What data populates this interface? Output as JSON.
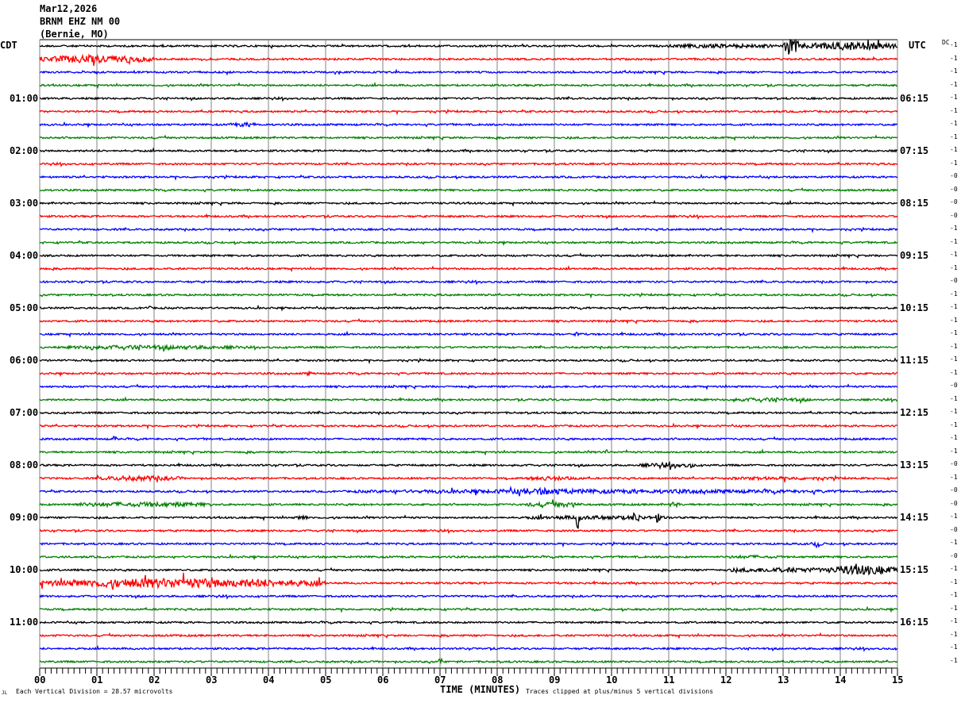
{
  "header": {
    "date": "Mar12,2026",
    "station": "BRNM EHZ NM 00",
    "location": "(Bernie, MO)"
  },
  "left_timezone": "CDT",
  "right_timezone": "UTC",
  "dc_label": "DC",
  "footer": {
    "mark": "JL",
    "scale": "Each Vertical Division =   28.57 microvolts",
    "clip_note": "Traces clipped at plus/minus 5 vertical divisions"
  },
  "chart_data": {
    "type": "line",
    "title": "",
    "xlabel": "TIME (MINUTES)",
    "xlim": [
      0,
      15
    ],
    "x_tick_labels": [
      "00",
      "01",
      "02",
      "03",
      "04",
      "05",
      "06",
      "07",
      "08",
      "09",
      "10",
      "11",
      "12",
      "13",
      "14",
      "15"
    ],
    "grid": "vertical lines every minute",
    "trace_colors": [
      "#000000",
      "#ff0000",
      "#0000ff",
      "#008000"
    ],
    "row_count": 48,
    "left_hour_labels": [
      {
        "row": 4,
        "label": "01:00"
      },
      {
        "row": 8,
        "label": "02:00"
      },
      {
        "row": 12,
        "label": "03:00"
      },
      {
        "row": 16,
        "label": "04:00"
      },
      {
        "row": 20,
        "label": "05:00"
      },
      {
        "row": 24,
        "label": "06:00"
      },
      {
        "row": 28,
        "label": "07:00"
      },
      {
        "row": 32,
        "label": "08:00"
      },
      {
        "row": 36,
        "label": "09:00"
      },
      {
        "row": 40,
        "label": "10:00"
      },
      {
        "row": 44,
        "label": "11:00"
      }
    ],
    "right_hour_labels": [
      {
        "row": 4,
        "label": "06:15"
      },
      {
        "row": 8,
        "label": "07:15"
      },
      {
        "row": 12,
        "label": "08:15"
      },
      {
        "row": 16,
        "label": "09:15"
      },
      {
        "row": 20,
        "label": "10:15"
      },
      {
        "row": 24,
        "label": "11:15"
      },
      {
        "row": 28,
        "label": "12:15"
      },
      {
        "row": 32,
        "label": "13:15"
      },
      {
        "row": 36,
        "label": "14:15"
      },
      {
        "row": 40,
        "label": "15:15"
      },
      {
        "row": 44,
        "label": "16:15"
      }
    ],
    "dc_offsets": [
      "-1",
      "-1",
      "-1",
      "-1",
      "-1",
      "-1",
      "-1",
      "-1",
      "-1",
      "-1",
      "-0",
      "-0",
      "-0",
      "-0",
      "-1",
      "-1",
      "-1",
      "-1",
      "-0",
      "-1",
      "-1",
      "-1",
      "-1",
      "-1",
      "-1",
      "-1",
      "-0",
      "-1",
      "-1",
      "-1",
      "-1",
      "-1",
      "-0",
      "-1",
      "-0",
      "-0",
      "-1",
      "-0",
      "-1",
      "-0",
      "-1",
      "-1",
      "-1",
      "-1",
      "-1",
      "-1",
      "-1",
      "-1"
    ],
    "events": [
      {
        "row": 0,
        "start": 11.0,
        "end": 13.0,
        "amplitude": 2.5
      },
      {
        "row": 0,
        "start": 13.0,
        "end": 13.3,
        "amplitude": 9
      },
      {
        "row": 0,
        "start": 13.3,
        "end": 15.0,
        "amplitude": 5
      },
      {
        "row": 1,
        "start": 0.0,
        "end": 2.0,
        "amplitude": 5
      },
      {
        "row": 6,
        "start": 3.3,
        "end": 3.9,
        "amplitude": 2.5
      },
      {
        "row": 20,
        "start": 1.85,
        "end": 1.95,
        "amplitude": 2.5
      },
      {
        "row": 22,
        "start": 9.3,
        "end": 9.5,
        "amplitude": 2.5
      },
      {
        "row": 23,
        "start": 0.5,
        "end": 3.5,
        "amplitude": 2.5
      },
      {
        "row": 23,
        "start": 0.85,
        "end": 0.95,
        "amplitude": 6
      },
      {
        "row": 25,
        "start": 4.65,
        "end": 4.75,
        "amplitude": 3
      },
      {
        "row": 27,
        "start": 12.0,
        "end": 13.5,
        "amplitude": 2.2
      },
      {
        "row": 30,
        "start": 1.28,
        "end": 1.34,
        "amplitude": 5
      },
      {
        "row": 31,
        "start": 9.86,
        "end": 9.92,
        "amplitude": 5
      },
      {
        "row": 32,
        "start": 10.5,
        "end": 11.5,
        "amplitude": 2.5
      },
      {
        "row": 32,
        "start": 11.38,
        "end": 11.42,
        "amplitude": 7
      },
      {
        "row": 33,
        "start": 1.0,
        "end": 2.5,
        "amplitude": 3
      },
      {
        "row": 33,
        "start": 8.5,
        "end": 9.5,
        "amplitude": 2.5
      },
      {
        "row": 33,
        "start": 12.0,
        "end": 14.0,
        "amplitude": 2
      },
      {
        "row": 34,
        "start": 5.5,
        "end": 14.0,
        "amplitude": 2.5
      },
      {
        "row": 34,
        "start": 8.0,
        "end": 9.5,
        "amplitude": 4
      },
      {
        "row": 35,
        "start": 0.5,
        "end": 3.0,
        "amplitude": 3
      },
      {
        "row": 35,
        "start": 8.5,
        "end": 9.5,
        "amplitude": 3
      },
      {
        "row": 35,
        "start": 11.0,
        "end": 11.2,
        "amplitude": 3
      },
      {
        "row": 36,
        "start": 4.5,
        "end": 4.7,
        "amplitude": 3
      },
      {
        "row": 36,
        "start": 8.5,
        "end": 11.0,
        "amplitude": 2.5
      },
      {
        "row": 36,
        "start": 9.38,
        "end": 9.45,
        "amplitude": 14
      },
      {
        "row": 36,
        "start": 10.35,
        "end": 10.5,
        "amplitude": 7
      },
      {
        "row": 36,
        "start": 10.75,
        "end": 10.85,
        "amplitude": 6
      },
      {
        "row": 38,
        "start": 13.5,
        "end": 13.7,
        "amplitude": 2.5
      },
      {
        "row": 39,
        "start": 12.0,
        "end": 13.0,
        "amplitude": 2
      },
      {
        "row": 40,
        "start": 12.0,
        "end": 14.0,
        "amplitude": 3
      },
      {
        "row": 40,
        "start": 13.8,
        "end": 15.0,
        "amplitude": 6
      },
      {
        "row": 41,
        "start": 0.0,
        "end": 5.0,
        "amplitude": 6
      },
      {
        "row": 47,
        "start": 6.98,
        "end": 7.04,
        "amplitude": 5
      }
    ]
  }
}
